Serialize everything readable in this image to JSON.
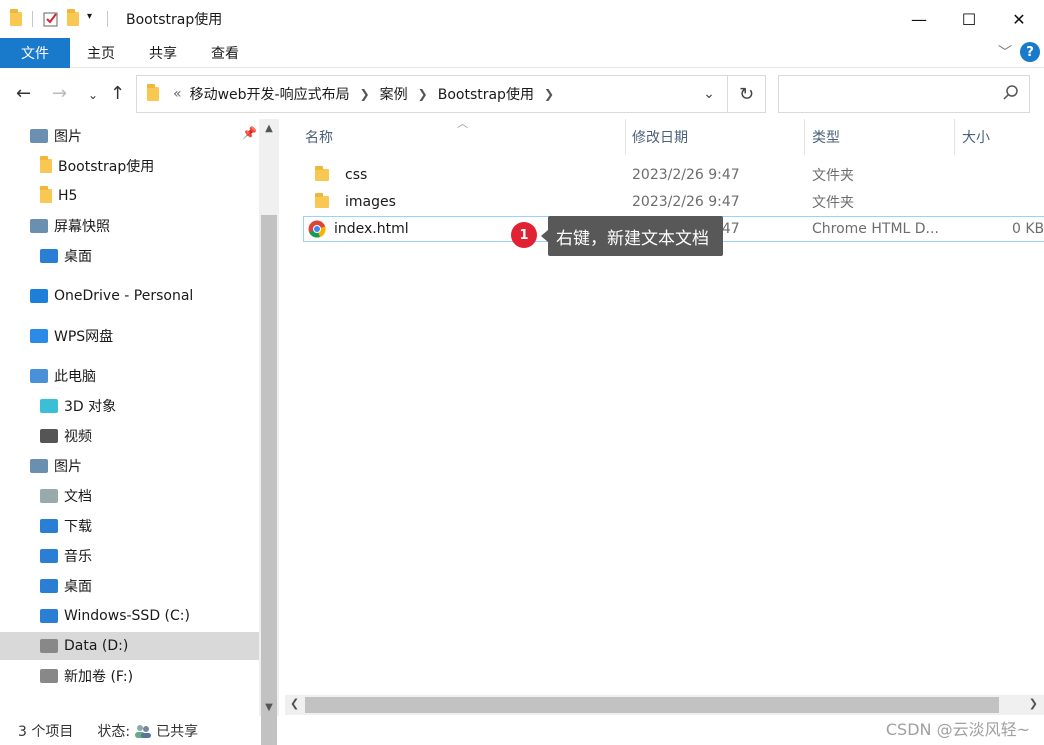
{
  "window": {
    "title": "Bootstrap使用",
    "minimize": "—",
    "maximize": "☐",
    "close": "✕"
  },
  "ribbon": {
    "tabs": [
      "文件",
      "主页",
      "共享",
      "查看"
    ],
    "help": "?"
  },
  "address": {
    "prefix": "«",
    "crumbs": [
      "移动web开发-响应式布局",
      "案例",
      "Bootstrap使用"
    ],
    "search_placeholder": ""
  },
  "nav": {
    "items": [
      {
        "label": "图片",
        "icon": "pictures-icon",
        "indent": 1
      },
      {
        "label": "Bootstrap使用",
        "icon": "folder-icon",
        "indent": 2
      },
      {
        "label": "H5",
        "icon": "folder-icon",
        "indent": 2
      },
      {
        "label": "屏幕快照",
        "icon": "screenshots-icon",
        "indent": 1
      },
      {
        "label": "桌面",
        "icon": "desktop-icon",
        "indent": 2
      },
      {
        "label": "OneDrive - Personal",
        "icon": "onedrive-icon",
        "indent": 0
      },
      {
        "label": "WPS网盘",
        "icon": "wps-cloud-icon",
        "indent": 0
      },
      {
        "label": "此电脑",
        "icon": "this-pc-icon",
        "indent": 0
      },
      {
        "label": "3D 对象",
        "icon": "3d-objects-icon",
        "indent": 2
      },
      {
        "label": "视频",
        "icon": "videos-icon",
        "indent": 2
      },
      {
        "label": "图片",
        "icon": "pictures-icon",
        "indent": 1
      },
      {
        "label": "文档",
        "icon": "documents-icon",
        "indent": 2
      },
      {
        "label": "下载",
        "icon": "downloads-icon",
        "indent": 2
      },
      {
        "label": "音乐",
        "icon": "music-icon",
        "indent": 2
      },
      {
        "label": "桌面",
        "icon": "desktop-icon",
        "indent": 2
      },
      {
        "label": "Windows-SSD (C:)",
        "icon": "windows-drive-icon",
        "indent": 2
      },
      {
        "label": "Data (D:)",
        "icon": "drive-icon",
        "indent": 2,
        "selected": true
      },
      {
        "label": "新加卷 (F:)",
        "icon": "drive-icon",
        "indent": 2
      }
    ]
  },
  "columns": [
    "名称",
    "修改日期",
    "类型",
    "大小"
  ],
  "files": [
    {
      "name": "css",
      "date": "2023/2/26 9:47",
      "type": "文件夹",
      "size": "",
      "icon": "folder-icon"
    },
    {
      "name": "images",
      "date": "2023/2/26 9:47",
      "type": "文件夹",
      "size": "",
      "icon": "folder-icon"
    },
    {
      "name": "index.html",
      "date": "2023/2/26 9:47",
      "type": "Chrome HTML D...",
      "size": "0 KB",
      "icon": "chrome-icon",
      "selected": true
    }
  ],
  "tooltip": {
    "number": "1",
    "text": "右键，新建文本文档"
  },
  "status": {
    "count": "3 个项目",
    "state_label": "状态:",
    "state_value": "已共享"
  },
  "watermark": "CSDN @云淡风轻~"
}
